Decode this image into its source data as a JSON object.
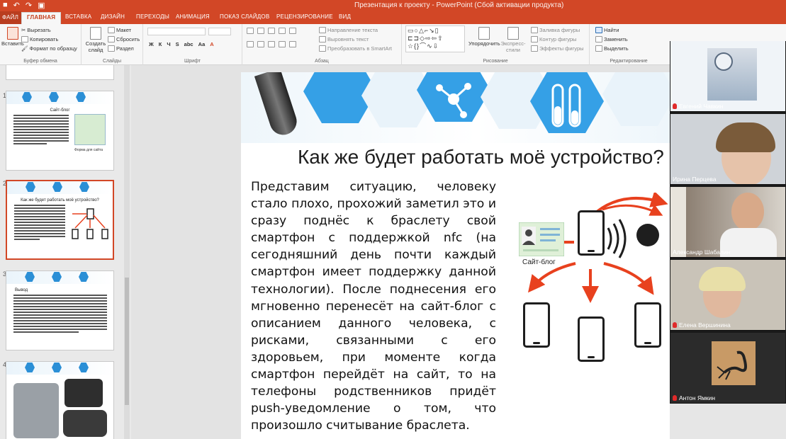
{
  "window": {
    "title": "Презентация к проекту - PowerPoint (Сбой активации продукта)"
  },
  "tabs": [
    "ФАЙЛ",
    "ГЛАВНАЯ",
    "ВСТАВКА",
    "ДИЗАЙН",
    "ПЕРЕХОДЫ",
    "АНИМАЦИЯ",
    "ПОКАЗ СЛАЙДОВ",
    "РЕЦЕНЗИРОВАНИЕ",
    "ВИД"
  ],
  "ribbon": {
    "clipboard": {
      "paste": "Вставить",
      "cut": "Вырезать",
      "copy": "Копировать",
      "format_painter": "Формат по образцу",
      "label": "Буфер обмена"
    },
    "slides": {
      "new_slide": "Создать слайд",
      "layout": "Макет",
      "reset": "Сбросить",
      "section": "Раздел",
      "label": "Слайды"
    },
    "font": {
      "label": "Шрифт",
      "bold": "Ж",
      "italic": "К",
      "underline": "Ч",
      "strike": "S",
      "spacing": "abc",
      "size_case": "Аа"
    },
    "paragraph": {
      "label": "Абзац",
      "text_direction": "Направление текста",
      "align_text": "Выровнять текст",
      "smartart": "Преобразовать в SmartArt"
    },
    "drawing": {
      "label": "Рисование",
      "arrange": "Упорядочить",
      "quick_styles": "Экспресс-стили",
      "fill": "Заливка фигуры",
      "outline": "Контур фигуры",
      "effects": "Эффекты фигуры"
    },
    "editing": {
      "label": "Редактирование",
      "find": "Найти",
      "replace": "Заменить",
      "select": "Выделить"
    }
  },
  "thumbnails": [
    {
      "number": "1",
      "title": "Сайт-блог",
      "caption": "Форма для сайта",
      "selected": false
    },
    {
      "number": "2",
      "title": "Как же будет работать моё устройство?",
      "selected": true
    },
    {
      "number": "3",
      "title": "Вывод",
      "selected": false
    },
    {
      "number": "4",
      "title": "",
      "selected": false
    }
  ],
  "slide": {
    "title": "Как же будет работать моё устройство?",
    "body": "Представим ситуацию, человеку стало плохо, прохожий заметил это и сразу поднёс к браслету свой смартфон с поддержкой nfc (на сегодняшний день почти каждый смартфон имеет поддержку данной технологии). После поднесения его мгновенно перенесёт на сайт-блог с описанием данного человека, с рисками, связанными с его здоровьем, при моменте когда смартфон перейдёт на сайт, то на телефоны родственников придёт push-уведомление о том, что произошло считывание браслета.",
    "card_label": "Сайт-блог"
  },
  "participants": [
    {
      "name": "Евгений Чавкин",
      "muted": true
    },
    {
      "name": "Ирина Перцева",
      "muted": false
    },
    {
      "name": "Александр Шабалин",
      "muted": false
    },
    {
      "name": "Елена Вершинина",
      "muted": true
    },
    {
      "name": "Антон Ямкин",
      "muted": true
    }
  ],
  "colors": {
    "accent": "#d24726",
    "hex_blue": "#35a0e6",
    "arrow_red": "#e8411e"
  }
}
